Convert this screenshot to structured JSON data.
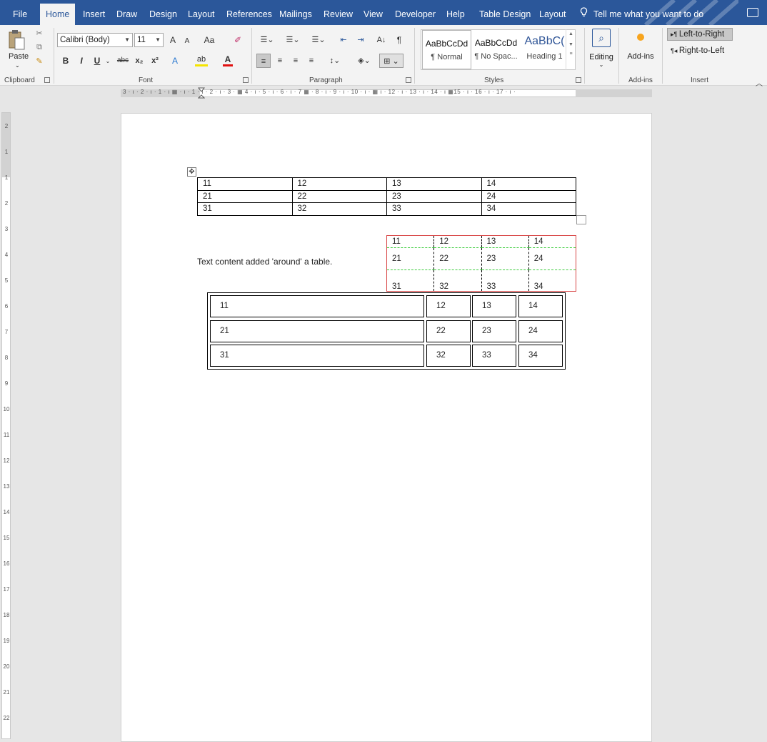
{
  "menu": {
    "tabs": [
      "File",
      "Home",
      "Insert",
      "Draw",
      "Design",
      "Layout",
      "References",
      "Mailings",
      "Review",
      "View",
      "Developer",
      "Help",
      "Table Design",
      "Layout"
    ],
    "active": "Home",
    "tell_me": "Tell me what you want to do"
  },
  "ribbon": {
    "clipboard": {
      "paste_label": "Paste",
      "group_label": "Clipboard"
    },
    "font": {
      "font_name": "Calibri (Body)",
      "font_size": "11",
      "grow": "A",
      "shrink": "A",
      "change_case": "Aa",
      "bold": "B",
      "italic": "I",
      "underline": "U",
      "strike": "abc",
      "subscript": "x₂",
      "superscript": "x²",
      "text_effects": "A",
      "highlight": "ab",
      "font_color": "A",
      "group_label": "Font"
    },
    "paragraph": {
      "sort": "A↓",
      "pilcrow": "¶",
      "group_label": "Paragraph"
    },
    "styles": {
      "items": [
        {
          "sample": "AaBbCcDd",
          "name": "¶ Normal"
        },
        {
          "sample": "AaBbCcDd",
          "name": "¶ No Spac..."
        },
        {
          "sample": "AaBbC(",
          "name": "Heading 1"
        }
      ],
      "group_label": "Styles"
    },
    "editing": {
      "label": "Editing"
    },
    "addins": {
      "label": "Add-ins",
      "group_label": "Add-ins"
    },
    "insert": {
      "ltr": "Left-to-Right",
      "rtl": "Right-to-Left",
      "group_label": "Insert"
    }
  },
  "ruler": {
    "horizontal_text": "3 · ı · 2 · ı · 1 · ı  ▦   · ı · 1 · ı · 2 · ı · 3 · ▦  4 · ı · 5 · ı · 6 · ı · 7 ▦  · 8 · ı · 9 · ı · 10 · ı · ▦  ı · 12 · ı · 13 · ı · 14 · ı ▦15 · ı · 16 · ı · 17 · ı ·",
    "vertical_numbers": [
      "2",
      "1",
      "1",
      "2",
      "3",
      "4",
      "5",
      "6",
      "7",
      "8",
      "9",
      "10",
      "11",
      "12",
      "13",
      "14",
      "15",
      "16",
      "17",
      "18",
      "19",
      "20",
      "21",
      "22"
    ]
  },
  "document": {
    "table1": [
      [
        "11",
        "12",
        "13",
        "14"
      ],
      [
        "21",
        "22",
        "23",
        "24"
      ],
      [
        "31",
        "32",
        "33",
        "34"
      ]
    ],
    "float_text": "Text content added 'around' a table.",
    "table2": [
      [
        "11",
        "12",
        "13",
        "14"
      ],
      [
        "21",
        "22",
        "23",
        "24"
      ],
      [
        "31",
        "32",
        "33",
        "34"
      ]
    ],
    "table3": [
      [
        "11",
        "12",
        "13",
        "14"
      ],
      [
        "21",
        "22",
        "23",
        "24"
      ],
      [
        "31",
        "32",
        "33",
        "34"
      ]
    ]
  },
  "colors": {
    "brand": "#2b579a",
    "table2_border": "#d84545",
    "table2_gridline": "#3ccc3c"
  }
}
